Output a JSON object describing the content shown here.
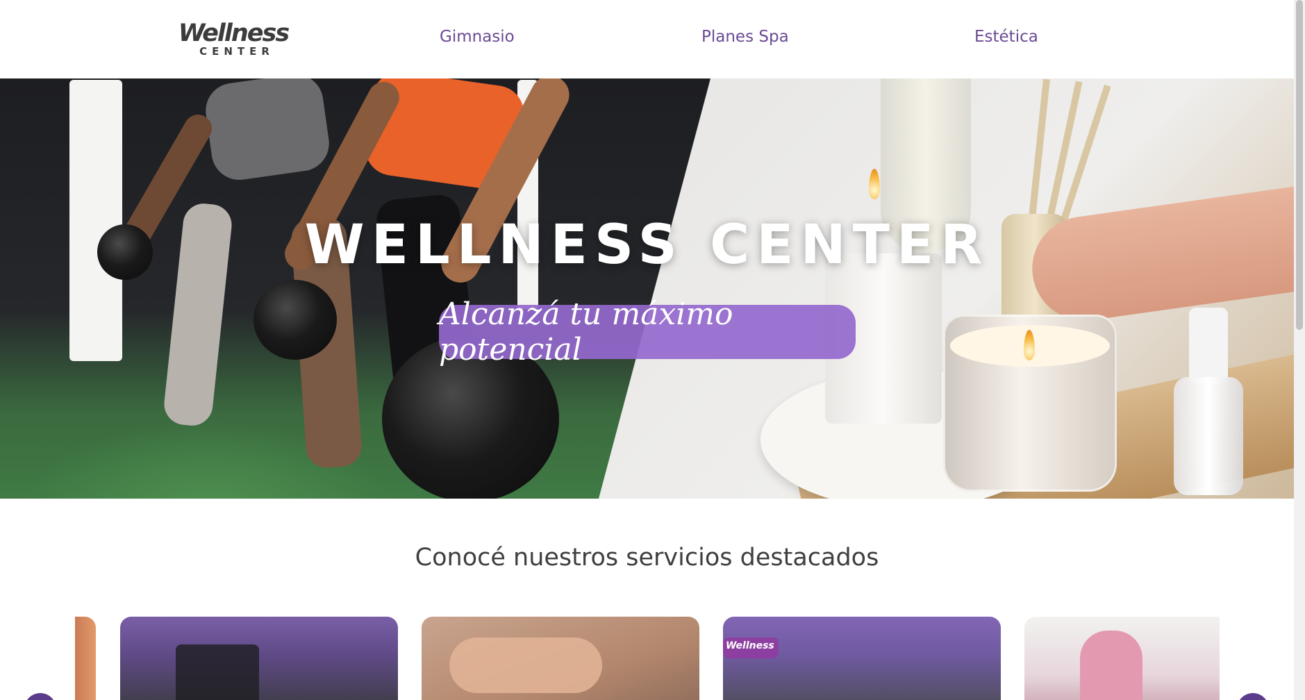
{
  "header": {
    "logo_main": "Wellness",
    "logo_sub": "CENTER",
    "nav": {
      "gym": "Gimnasio",
      "spa": "Planes Spa",
      "esthetics": "Estética"
    }
  },
  "hero": {
    "title": "WELLNESS CENTER",
    "tagline": "Alcanzá tu máximo potencial"
  },
  "services": {
    "title": "Conocé nuestros servicios destacados",
    "card3_sign": "Wellness"
  },
  "colors": {
    "brand_purple": "#6a4a94",
    "pill_purple": "#9468cd",
    "arrow_purple": "#5b3c8c"
  }
}
